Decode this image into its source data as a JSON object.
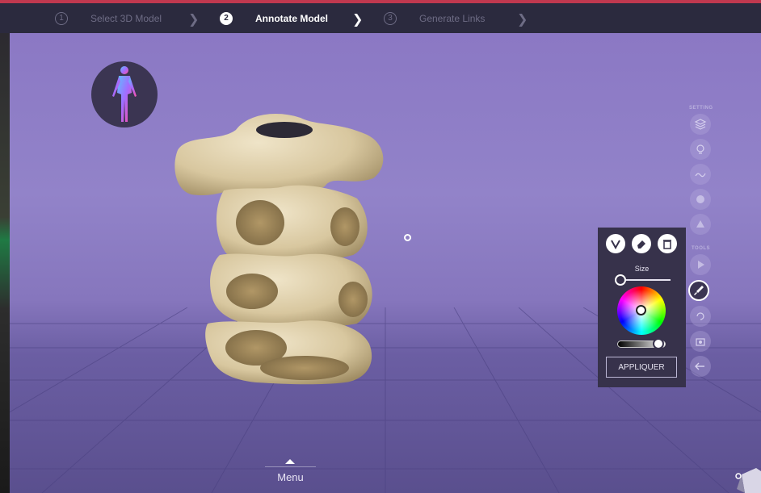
{
  "stepper": {
    "steps": [
      {
        "number": "1",
        "label": "Select 3D Model"
      },
      {
        "number": "2",
        "label": "Annotate Model"
      },
      {
        "number": "3",
        "label": "Generate Links"
      }
    ]
  },
  "sidebar": {
    "setting_label": "SETTING",
    "tools_label": "TOOLS",
    "setting_icons": [
      "layers-icon",
      "light-icon",
      "texture-icon",
      "material-icon",
      "effects-icon"
    ],
    "tool_icons": [
      "play-icon",
      "paint-brush-icon",
      "rotate-icon",
      "camera-icon",
      "undo-icon"
    ]
  },
  "paint_panel": {
    "size_label": "Size",
    "apply_label": "APPLIQUER",
    "size_value": 0.05,
    "brightness_value": 0.88,
    "selected_color": "#ffffff"
  },
  "menu": {
    "label": "Menu"
  },
  "colors": {
    "accent": "#c0384f",
    "topbar": "#2b2a3e",
    "panel": "#37324b",
    "background": "#8b78c4"
  }
}
